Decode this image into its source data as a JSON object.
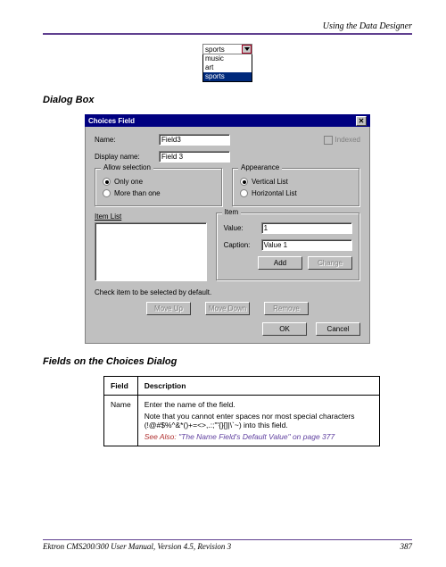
{
  "header": {
    "section": "Using the Data Designer"
  },
  "dropdown": {
    "selected": "sports",
    "options": [
      "music",
      "art",
      "sports"
    ]
  },
  "section1_heading": "Dialog Box",
  "dialog": {
    "title": "Choices Field",
    "name_label": "Name:",
    "name_value": "Field3",
    "indexed_label": "Indexed",
    "display_label": "Display name:",
    "display_value": "Field 3",
    "allow_legend": "Allow selection",
    "allow_only_one": "Only one",
    "allow_more": "More than one",
    "appearance_legend": "Appearance",
    "vertical": "Vertical List",
    "horizontal": "Horizontal List",
    "itemlist_label": "Item List",
    "item_legend": "Item",
    "value_label": "Value:",
    "value_value": "1",
    "caption_label": "Caption:",
    "caption_value": "Value 1",
    "add": "Add",
    "change": "Change",
    "hint": "Check item to be selected by default.",
    "moveup": "Move Up",
    "movedown": "Move Down",
    "remove": "Remove",
    "ok": "OK",
    "cancel": "Cancel"
  },
  "section2_heading": "Fields on the Choices Dialog",
  "table": {
    "col_field": "Field",
    "col_desc": "Description",
    "row1_field": "Name",
    "row1_desc1": "Enter the name of the field.",
    "row1_desc2": "Note that you cannot enter spaces nor most special characters (!@#$%^&*()+=<>,.:;\"'{}[]|\\`~) into this field.",
    "row1_see_label": "See Also:",
    "row1_see_link": "\"The Name Field's Default Value\" on page 377"
  },
  "footer": {
    "left": "Ektron CMS200/300 User Manual, Version 4.5, Revision 3",
    "page": "387"
  }
}
